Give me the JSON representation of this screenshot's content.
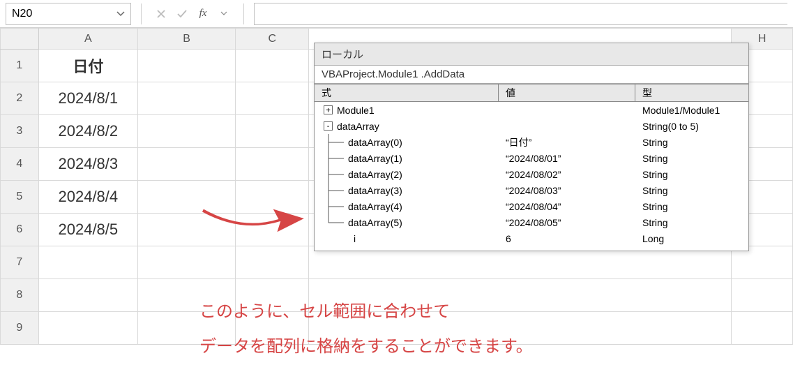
{
  "formula_bar": {
    "name_box": "N20",
    "cancel_symbol": "✕",
    "accept_symbol": "✓",
    "fx_symbol": "fx",
    "caret_symbol": "▾",
    "formula_value": ""
  },
  "columns": [
    "A",
    "B",
    "C",
    "H"
  ],
  "row_numbers": [
    "1",
    "2",
    "3",
    "4",
    "5",
    "6",
    "7",
    "8",
    "9"
  ],
  "column_A": {
    "header": "日付",
    "rows": [
      "2024/8/1",
      "2024/8/2",
      "2024/8/3",
      "2024/8/4",
      "2024/8/5",
      "",
      "",
      ""
    ]
  },
  "locals": {
    "title": "ローカル",
    "subtitle": "VBAProject.Module1 .AddData",
    "headers": {
      "expr": "式",
      "value": "値",
      "type": "型"
    },
    "rows": [
      {
        "icon": "+",
        "indent": 0,
        "expr": "Module1",
        "value": "",
        "type": "Module1/Module1"
      },
      {
        "icon": "-",
        "indent": 0,
        "expr": "dataArray",
        "value": "",
        "type": "String(0 to 5)"
      },
      {
        "icon": "mid",
        "indent": 1,
        "expr": "dataArray(0)",
        "value": "“日付”",
        "type": "String"
      },
      {
        "icon": "mid",
        "indent": 1,
        "expr": "dataArray(1)",
        "value": "“2024/08/01”",
        "type": "String"
      },
      {
        "icon": "mid",
        "indent": 1,
        "expr": "dataArray(2)",
        "value": "“2024/08/02”",
        "type": "String"
      },
      {
        "icon": "mid",
        "indent": 1,
        "expr": "dataArray(3)",
        "value": "“2024/08/03”",
        "type": "String"
      },
      {
        "icon": "mid",
        "indent": 1,
        "expr": "dataArray(4)",
        "value": "“2024/08/04”",
        "type": "String"
      },
      {
        "icon": "end",
        "indent": 1,
        "expr": "dataArray(5)",
        "value": "“2024/08/05”",
        "type": "String"
      },
      {
        "icon": "",
        "indent": 1,
        "expr": "i",
        "value": "6",
        "type": "Long"
      }
    ]
  },
  "annotation": {
    "line1": "このように、セル範囲に合わせて",
    "line2": "データを配列に格納をすることができます。"
  }
}
